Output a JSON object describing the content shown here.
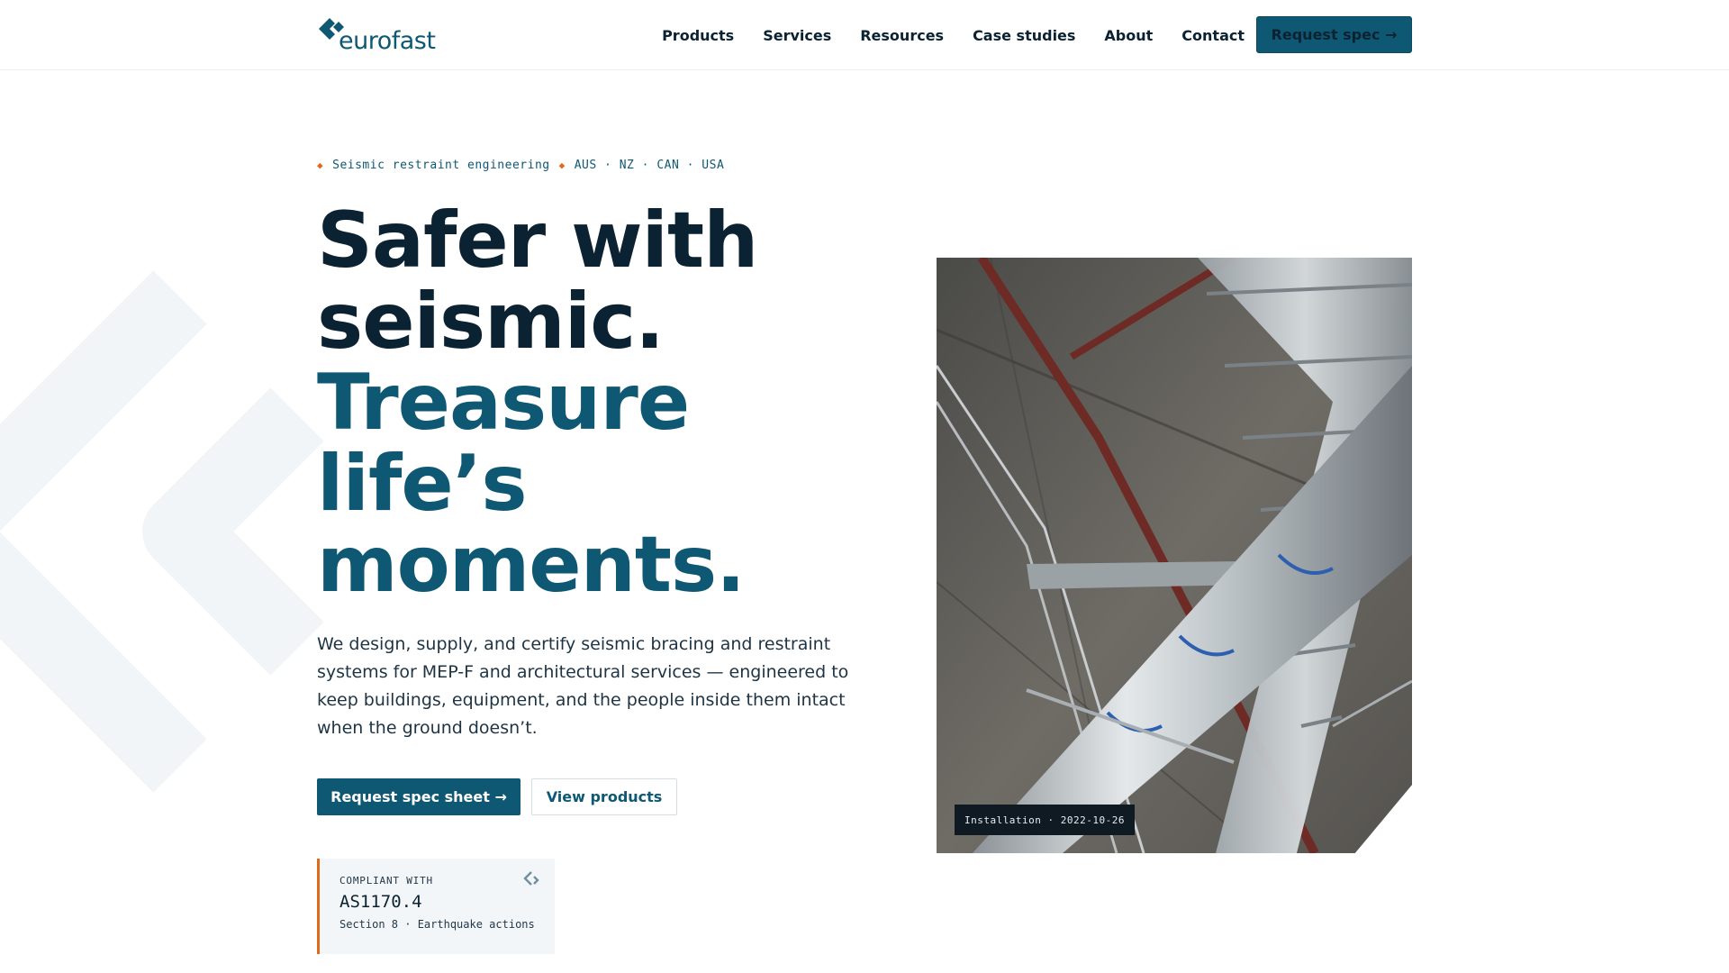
{
  "brand": {
    "name": "eurofast",
    "color": "#0e5873",
    "accent": "#e06a1b"
  },
  "nav": {
    "items": [
      "Products",
      "Services",
      "Resources",
      "Case studies",
      "About",
      "Contact"
    ],
    "cta": "Request spec →"
  },
  "hero": {
    "eyebrow": {
      "left": "Seismic restraint engineering",
      "right": "AUS · NZ · CAN · USA"
    },
    "headline_dark": [
      "Safer with",
      "seismic."
    ],
    "headline_accent": [
      "Treasure",
      "life’s",
      "moments."
    ],
    "lede": "We design, supply, and certify seismic bracing and restraint systems for MEP-F and architectural services — engineered to keep buildings, equipment, and the people inside them intact when the ground doesn’t.",
    "primary_cta": "Request spec sheet →",
    "secondary_cta": "View products"
  },
  "compliance": {
    "label": "COMPLIANT WITH",
    "code": "AS1170.4",
    "sub": "Section 8 · Earthquake actions"
  },
  "photo": {
    "caption": "Installation · 2022-10-26"
  },
  "icons": {
    "logo_mark": "eurofast-logo-icon",
    "eyebrow_marker": "diamond-icon",
    "compliance_mark": "logo-mark-icon",
    "watermark": "brand-watermark"
  }
}
